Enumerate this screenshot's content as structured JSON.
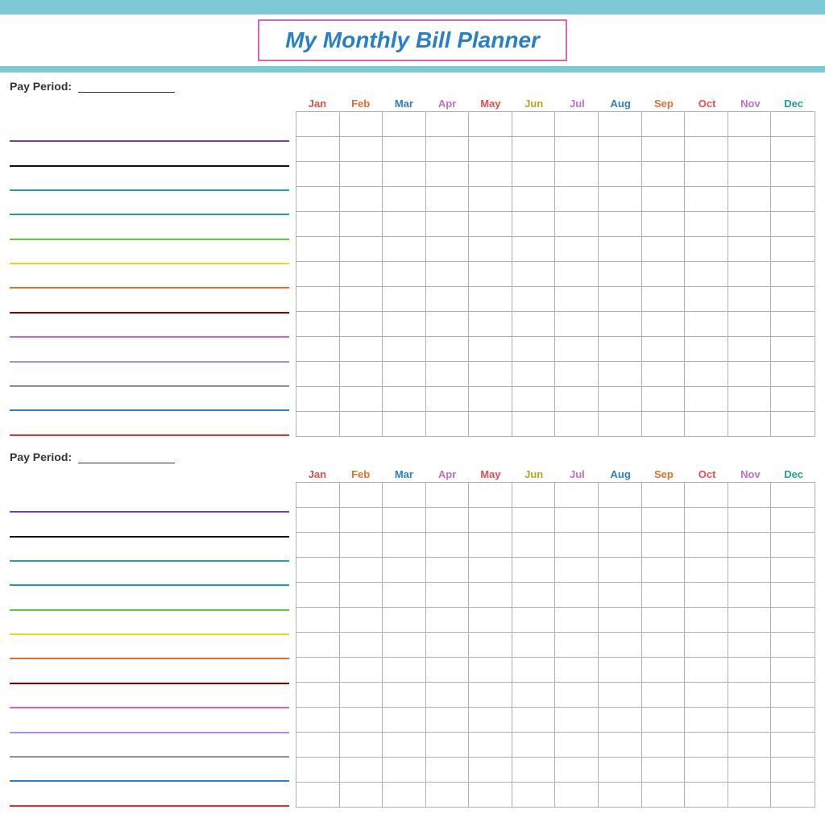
{
  "title": "My Monthly Bill Planner",
  "header": {
    "top_banner_color": "#7ec8d8",
    "title_border_color": "#d966b3",
    "title_text_color": "#2b7fc4"
  },
  "pay_period": {
    "label": "Pay Period:"
  },
  "months": [
    {
      "key": "jan",
      "label": "Jan",
      "class": "col-jan"
    },
    {
      "key": "feb",
      "label": "Feb",
      "class": "col-feb"
    },
    {
      "key": "mar",
      "label": "Mar",
      "class": "col-mar"
    },
    {
      "key": "apr",
      "label": "Apr",
      "class": "col-apr"
    },
    {
      "key": "may",
      "label": "May",
      "class": "col-may"
    },
    {
      "key": "jun",
      "label": "Jun",
      "class": "col-jun"
    },
    {
      "key": "jul",
      "label": "Jul",
      "class": "col-jul"
    },
    {
      "key": "aug",
      "label": "Aug",
      "class": "col-aug"
    },
    {
      "key": "sep",
      "label": "Sep",
      "class": "col-sep"
    },
    {
      "key": "oct",
      "label": "Oct",
      "class": "col-oct"
    },
    {
      "key": "nov",
      "label": "Nov",
      "class": "col-nov"
    },
    {
      "key": "dec",
      "label": "Dec",
      "class": "col-dec"
    }
  ],
  "bill_lines": [
    {
      "color": "line-purple"
    },
    {
      "color": "line-black"
    },
    {
      "color": "line-teal"
    },
    {
      "color": "line-teal2"
    },
    {
      "color": "line-green"
    },
    {
      "color": "line-yellow"
    },
    {
      "color": "line-orange"
    },
    {
      "color": "line-darkred"
    },
    {
      "color": "line-pink"
    },
    {
      "color": "line-lavender"
    },
    {
      "color": "line-gray"
    },
    {
      "color": "line-blue"
    },
    {
      "color": "line-red"
    }
  ],
  "num_rows": 13
}
